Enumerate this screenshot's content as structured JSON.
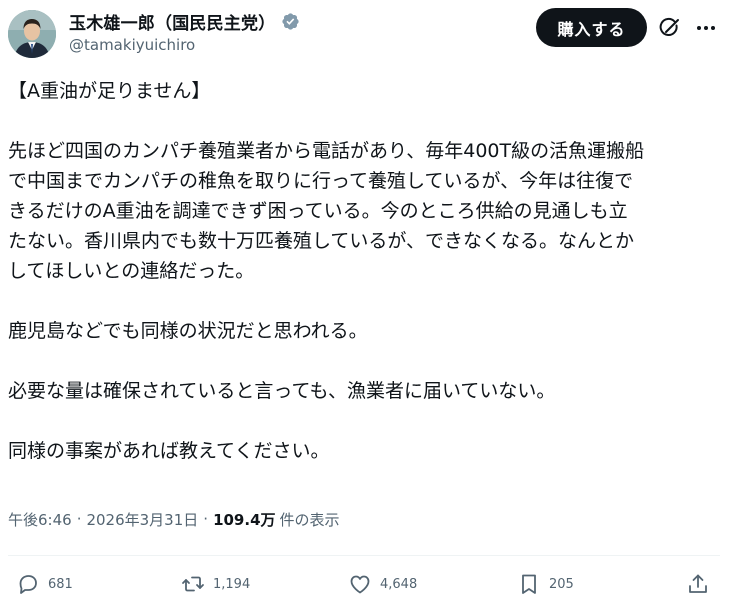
{
  "author": {
    "display_name": "玉木雄一郎（国民民主党）",
    "handle": "@tamakiyuichiro",
    "verified_color": "#829aab"
  },
  "header": {
    "buy_button_label": "購入する",
    "grok_icon": "grok-icon",
    "more_icon": "more-icon"
  },
  "tweet": {
    "title": "【A重油が足りません】",
    "paragraph1_lines": [
      "先ほど四国のカンパチ養殖業者から電話があり、毎年400T級の活魚運搬船",
      "で中国までカンパチの稚魚を取りに行って養殖しているが、今年は往復で",
      "きるだけのA重油を調達できず困っている。今のところ供給の見通しも立",
      "たない。香川県内でも数十万匹養殖しているが、できなくなる。なんとか",
      "してほしいとの連絡だった。"
    ],
    "paragraph2": "鹿児島などでも同様の状況だと思われる。",
    "paragraph3": "必要な量は確保されていると言っても、漁業者に届いていない。",
    "paragraph4": "同様の事案があれば教えてください。"
  },
  "meta": {
    "time": "午後6:46",
    "separator": "·",
    "date": "2026年3月31日",
    "views_count": "109.4万",
    "views_label": "件の表示"
  },
  "actions": {
    "replies": "681",
    "reposts": "1,194",
    "likes": "4,648",
    "bookmarks": "205"
  },
  "colors": {
    "text": "#0f1419",
    "secondary": "#536471",
    "divider": "#eff3f4",
    "button_bg": "#0f1419"
  }
}
